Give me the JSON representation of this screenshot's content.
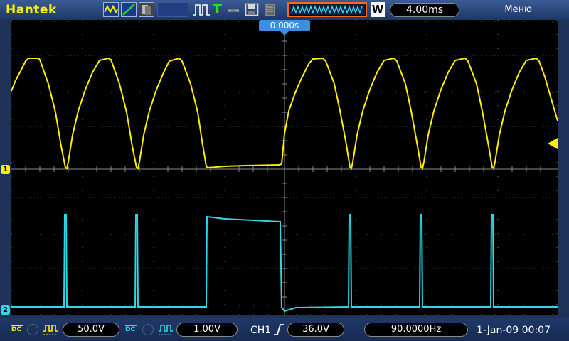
{
  "header": {
    "brand": "Hantek",
    "trigger_mode": "T",
    "timebase_label": "W",
    "timebase": "4.00ms",
    "menu": "Меню"
  },
  "screen": {
    "trigger_time": "0.000s",
    "ch1_marker": "1",
    "ch2_marker": "2"
  },
  "footer": {
    "ch1_scale": "50.0V",
    "ch2_scale": "1.00V",
    "trigger_source": "CH1",
    "trigger_level": "36.0V",
    "frequency": "90.0000Hz",
    "datetime": "1-Jan-09 00:07",
    "coupling_label": "DC"
  },
  "colors": {
    "ch1": "#ffee00",
    "ch2": "#2ed8e6",
    "accent": "#ff6a1a",
    "grid": "#5a5a5a"
  }
}
